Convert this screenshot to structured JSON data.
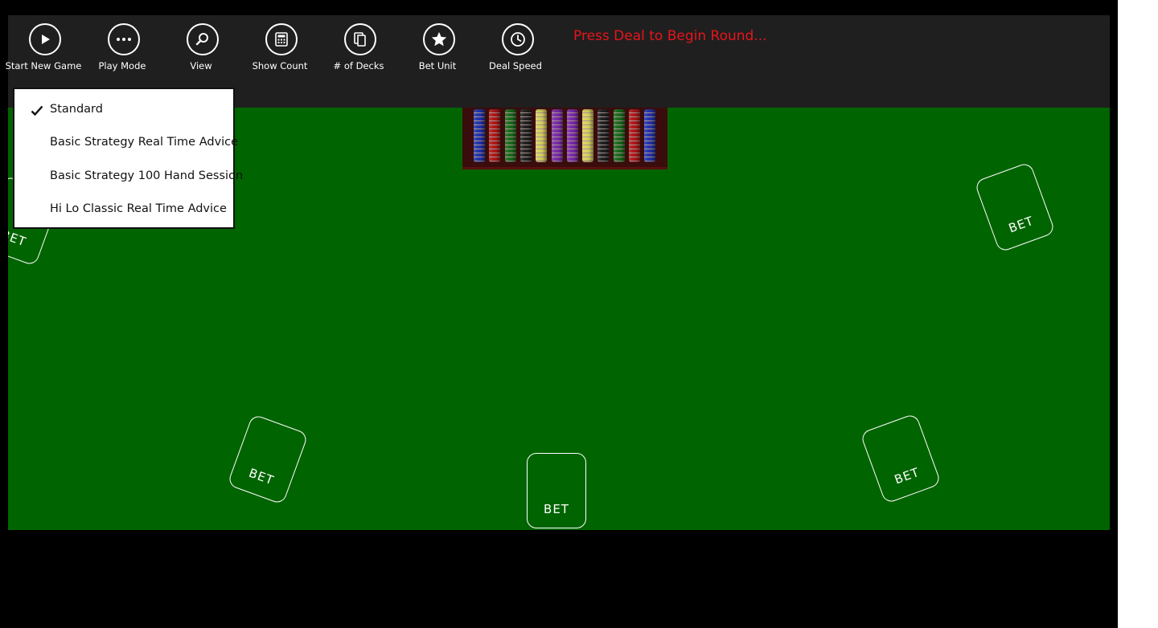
{
  "toolbar": {
    "buttons": [
      {
        "label": "Start New Game",
        "icon": "play-icon"
      },
      {
        "label": "Play Mode",
        "icon": "ellipsis-icon"
      },
      {
        "label": "View",
        "icon": "search-icon"
      },
      {
        "label": "Show Count",
        "icon": "calculator-icon"
      },
      {
        "label": "# of Decks",
        "icon": "decks-icon"
      },
      {
        "label": "Bet Unit",
        "icon": "star-icon"
      },
      {
        "label": "Deal Speed",
        "icon": "clock-icon"
      }
    ],
    "status_text": "Press Deal to Begin Round..."
  },
  "play_mode_menu": {
    "items": [
      {
        "label": "Standard",
        "checked": true
      },
      {
        "label": "Basic Strategy Real Time Advice",
        "checked": false
      },
      {
        "label": "Basic Strategy 100 Hand Session",
        "checked": false
      },
      {
        "label": "Hi Lo Classic Real Time Advice",
        "checked": false
      }
    ]
  },
  "table": {
    "bet_label": "BET",
    "table_color": "#006400",
    "chip_colors": [
      "#2233aa",
      "#b01818",
      "#1a6a1a",
      "#222222",
      "#d8d060",
      "#7a2aa8",
      "#7a2aa8",
      "#d8d060",
      "#222222",
      "#1a6a1a",
      "#b01818",
      "#2233aa"
    ]
  },
  "colors": {
    "status": "#e8141c",
    "appbar": "#1f1f1f"
  }
}
